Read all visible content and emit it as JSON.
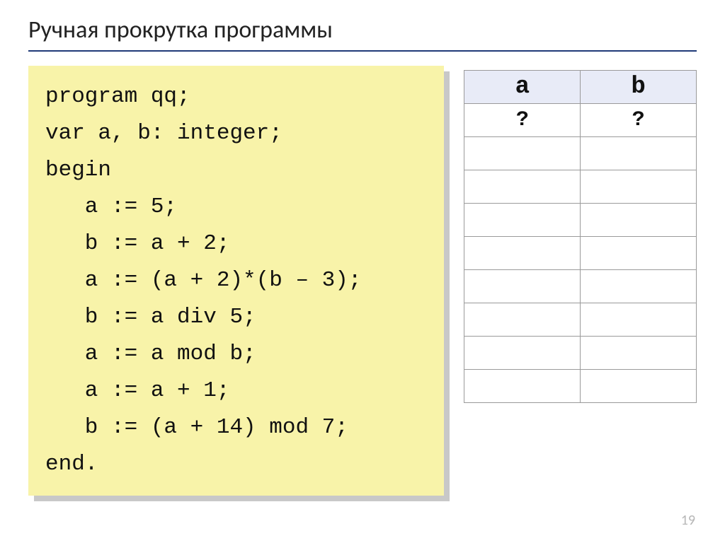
{
  "title": "Ручная прокрутка программы",
  "code": {
    "l1": "program qq;",
    "l2": "var a, b: integer;",
    "l3": "begin",
    "l4": "   a := 5;",
    "l5": "   b := a + 2;",
    "l6": "   a := (a + 2)*(b – 3);",
    "l7": "   b := a div 5;",
    "l8": "   a := a mod b;",
    "l9": "   a := a + 1;",
    "l10": "   b := (a + 14) mod 7;",
    "l11": "end."
  },
  "table": {
    "headers": {
      "c0": "a",
      "c1": "b"
    },
    "rows": [
      {
        "c0": "?",
        "c1": "?"
      },
      {
        "c0": "",
        "c1": ""
      },
      {
        "c0": "",
        "c1": ""
      },
      {
        "c0": "",
        "c1": ""
      },
      {
        "c0": "",
        "c1": ""
      },
      {
        "c0": "",
        "c1": ""
      },
      {
        "c0": "",
        "c1": ""
      },
      {
        "c0": "",
        "c1": ""
      },
      {
        "c0": "",
        "c1": ""
      }
    ]
  },
  "page_number": "19"
}
